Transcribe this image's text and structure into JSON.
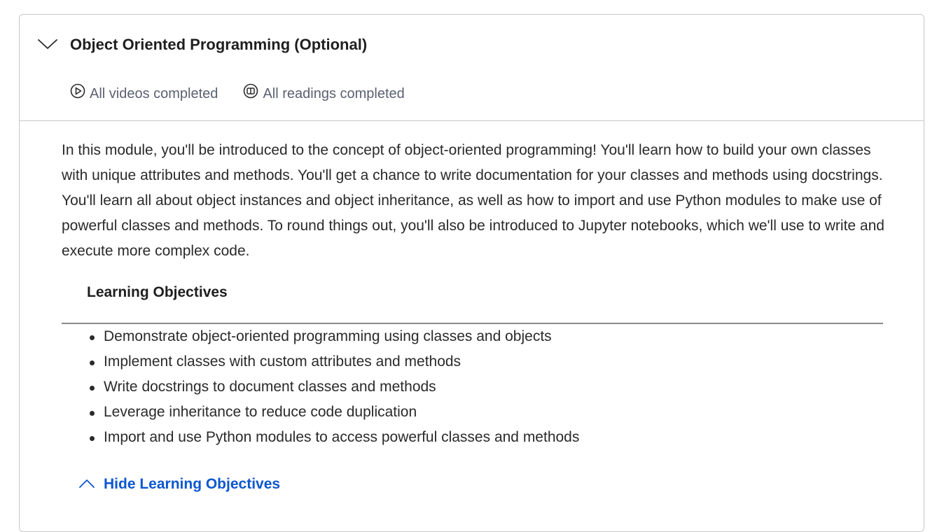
{
  "module": {
    "title": "Object Oriented Programming (Optional)",
    "expanded": true,
    "status": {
      "videos": "All videos completed",
      "readings": "All readings completed"
    },
    "description": "In this module, you'll be introduced to the concept of object-oriented programming! You'll learn how to build your own classes with unique attributes and methods. You'll get a chance to write documentation for your classes and methods using docstrings. You'll learn all about object instances and object inheritance, as well as how to import and use Python modules to make use of powerful classes and methods. To round things out, you'll also be introduced to Jupyter notebooks, which we'll use to write and execute more complex code.",
    "objectives_heading": "Learning Objectives",
    "objectives": [
      "Demonstrate object-oriented programming using classes and objects",
      "Implement classes with custom attributes and methods",
      "Write docstrings to document classes and methods",
      "Leverage inheritance to reduce code duplication",
      "Import and use Python modules to access powerful classes and methods"
    ],
    "hide_objectives_label": "Hide Learning Objectives"
  },
  "colors": {
    "link": "#0b57d0",
    "border": "#c7c7c7",
    "muted_text": "#5b6170"
  },
  "icons": {
    "collapse": "chevron-down-icon",
    "videos": "play-circle-icon",
    "readings": "book-circle-icon",
    "hide": "chevron-up-icon"
  }
}
